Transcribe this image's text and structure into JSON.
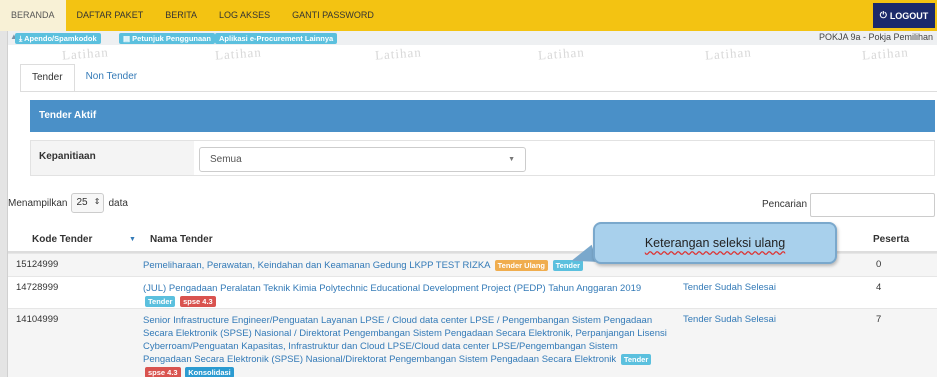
{
  "nav": {
    "items": [
      "BERANDA",
      "DAFTAR PAKET",
      "BERITA",
      "LOG AKSES",
      "GANTI PASSWORD"
    ],
    "logout": "LOGOUT"
  },
  "quicklinks": [
    "Apendo/Spamkodok",
    "Petunjuk Penggunaan",
    "Aplikasi e-Procurement Lainnya"
  ],
  "user_info": "POKJA 9a - Pokja Pemilihan",
  "watermark_text": "Latihan",
  "tabs": [
    "Tender",
    "Non Tender"
  ],
  "panel_title": "Tender Aktif",
  "filter": {
    "label": "Kepanitiaan",
    "value": "Semua"
  },
  "length": {
    "prefix": "Menampilkan",
    "value": "25",
    "suffix": "data"
  },
  "search_label": "Pencarian",
  "columns": {
    "kode": "Kode Tender",
    "nama": "Nama Tender",
    "peserta": "Peserta"
  },
  "rows": [
    {
      "kode": "15124999",
      "nama": "Pemeliharaan, Perawatan, Keindahan dan Keamanan Gedung LKPP TEST RIZKA",
      "badges": [
        "Tender Ulang",
        "Tender"
      ],
      "status": "",
      "peserta": "0"
    },
    {
      "kode": "14728999",
      "nama": "(JUL) Pengadaan Peralatan Teknik Kimia Polytechnic Educational Development Project (PEDP) Tahun Anggaran 2019",
      "badges": [
        "Tender",
        "spse 4.3"
      ],
      "status": "Tender Sudah Selesai",
      "peserta": "4"
    },
    {
      "kode": "14104999",
      "nama": "Senior Infrastructure Engineer/Penguatan Layanan LPSE / Cloud data center LPSE / Pengembangan Sistem Pengadaan Secara Elektronik (SPSE) Nasional / Direktorat Pengembangan Sistem Pengadaan Secara Elektronik, Perpanjangan Lisensi Cyberroam/Penguatan Kapasitas, Infrastruktur dan Cloud LPSE/Cloud data center LPSE/Pengembangan Sistem Pengadaan Secara Elektronik (SPSE) Nasional/Direktorat Pengembangan Sistem Pengadaan Secara Elektronik",
      "badges": [
        "Tender",
        "spse 4.3",
        "Konsolidasi"
      ],
      "status": "Tender Sudah Selesai",
      "peserta": "7"
    }
  ],
  "callout": "Keterangan seleksi ulang",
  "colors": {
    "nav_bg": "#f3c312",
    "logout_bg": "#1b2a6b",
    "panel_bg": "#4a90c8",
    "link": "#337ab7"
  }
}
